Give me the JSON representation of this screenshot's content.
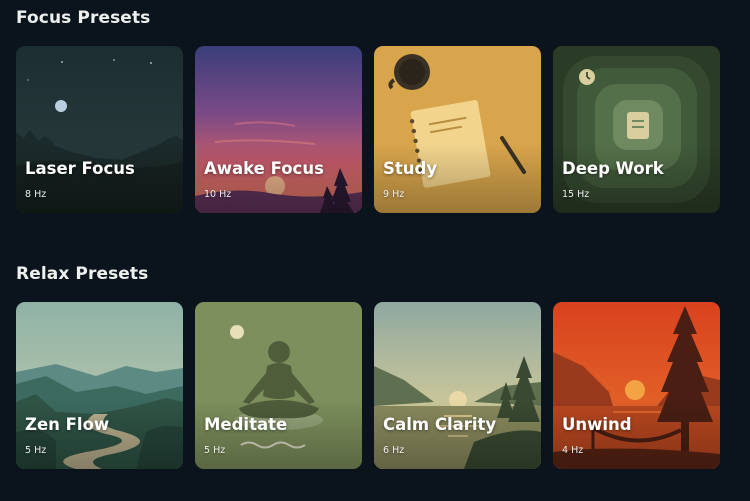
{
  "focus": {
    "title": "Focus Presets",
    "cards": [
      {
        "name": "Laser Focus",
        "hz": "8 Hz"
      },
      {
        "name": "Awake Focus",
        "hz": "10 Hz"
      },
      {
        "name": "Study",
        "hz": "9 Hz"
      },
      {
        "name": "Deep Work",
        "hz": "15 Hz"
      }
    ]
  },
  "relax": {
    "title": "Relax Presets",
    "cards": [
      {
        "name": "Zen Flow",
        "hz": "5 Hz"
      },
      {
        "name": "Meditate",
        "hz": "5 Hz"
      },
      {
        "name": "Calm Clarity",
        "hz": "6 Hz"
      },
      {
        "name": "Unwind",
        "hz": "4 Hz"
      }
    ]
  },
  "colors": {
    "background": "#0b141c",
    "text": "#f1f1ee"
  }
}
